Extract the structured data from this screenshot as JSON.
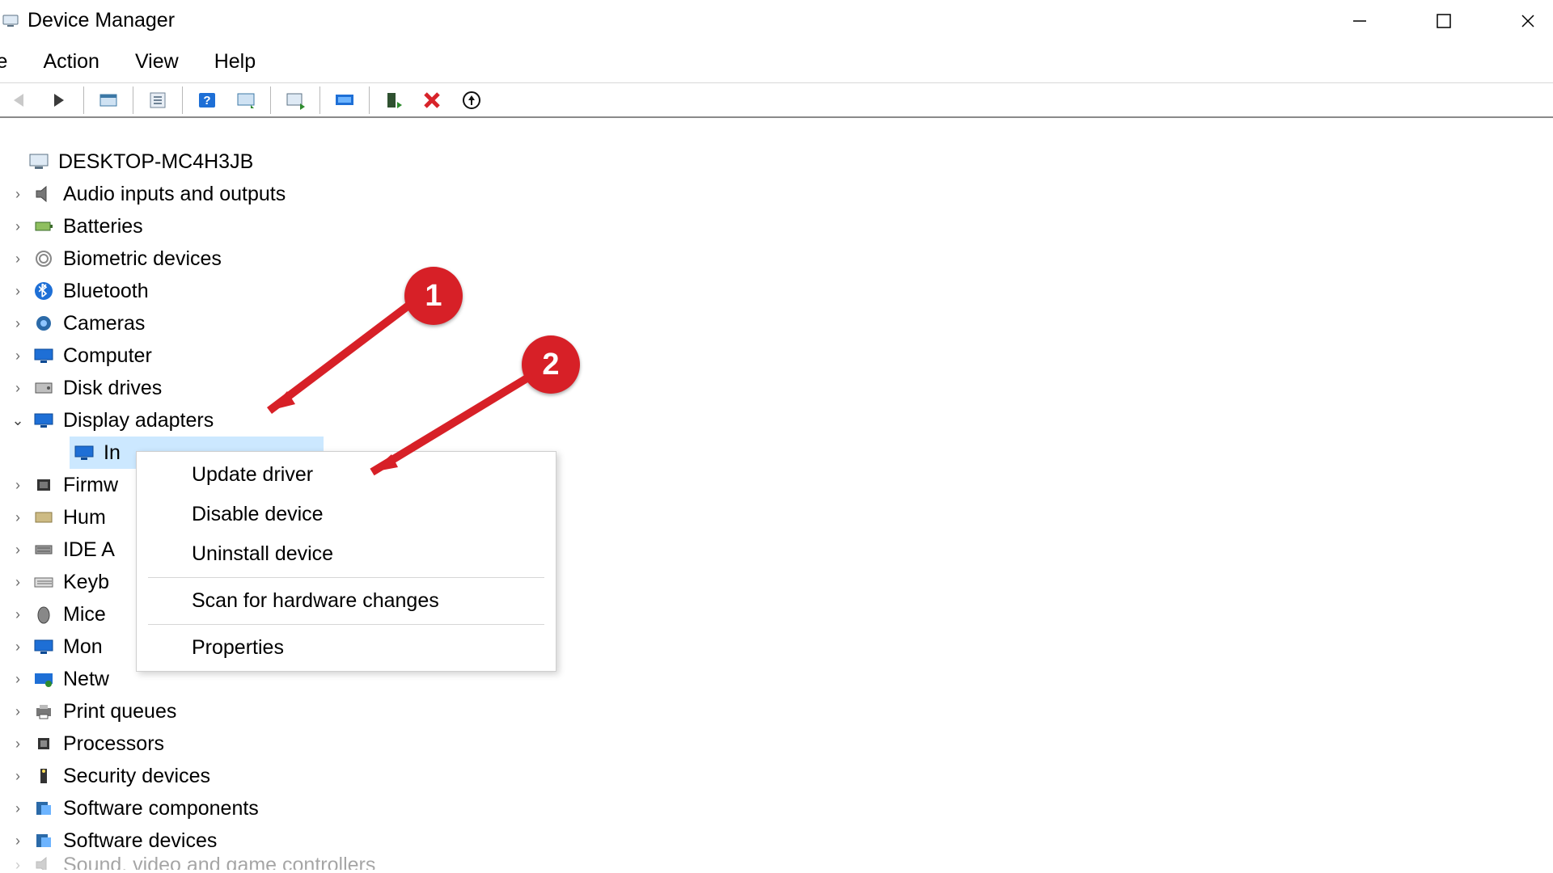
{
  "window": {
    "title": "Device Manager"
  },
  "menubar": {
    "items": [
      "le",
      "Action",
      "View",
      "Help"
    ]
  },
  "toolbar": {
    "buttons": [
      {
        "name": "back",
        "sep_after": false,
        "sep_before": false
      },
      {
        "name": "forward",
        "sep_after": true
      },
      {
        "name": "show-hidden",
        "sep_after": true
      },
      {
        "name": "properties",
        "sep_after": true
      },
      {
        "name": "help",
        "sep_after": false
      },
      {
        "name": "refresh",
        "sep_after": true
      },
      {
        "name": "update-driver",
        "sep_after": true
      },
      {
        "name": "scan-hardware",
        "sep_after": true
      },
      {
        "name": "add-legacy",
        "sep_after": false
      },
      {
        "name": "remove",
        "sep_after": false
      },
      {
        "name": "install-driver",
        "sep_after": false
      }
    ]
  },
  "tree": {
    "root": "DESKTOP-MC4H3JB",
    "categories": [
      {
        "label": "Audio inputs and outputs",
        "icon": "speaker",
        "expanded": false
      },
      {
        "label": "Batteries",
        "icon": "battery",
        "expanded": false
      },
      {
        "label": "Biometric devices",
        "icon": "fingerprint",
        "expanded": false
      },
      {
        "label": "Bluetooth",
        "icon": "bluetooth",
        "expanded": false
      },
      {
        "label": "Cameras",
        "icon": "camera",
        "expanded": false
      },
      {
        "label": "Computer",
        "icon": "monitor",
        "expanded": false
      },
      {
        "label": "Disk drives",
        "icon": "disk",
        "expanded": false
      },
      {
        "label": "Display adapters",
        "icon": "monitor",
        "expanded": true,
        "children": [
          {
            "label": "In"
          }
        ]
      },
      {
        "label": "Firmw",
        "icon": "chip",
        "expanded": false,
        "truncated": true
      },
      {
        "label": "Hum",
        "icon": "hid",
        "expanded": false,
        "truncated": true
      },
      {
        "label": "IDE A",
        "icon": "ide",
        "expanded": false,
        "truncated": true
      },
      {
        "label": "Keyb",
        "icon": "keyboard",
        "expanded": false,
        "truncated": true
      },
      {
        "label": "Mice",
        "icon": "mouse",
        "expanded": false,
        "truncated": true
      },
      {
        "label": "Mon",
        "icon": "monitor",
        "expanded": false,
        "truncated": true
      },
      {
        "label": "Netw",
        "icon": "network",
        "expanded": false,
        "truncated": true
      },
      {
        "label": "Print queues",
        "icon": "printer",
        "expanded": false
      },
      {
        "label": "Processors",
        "icon": "cpu",
        "expanded": false
      },
      {
        "label": "Security devices",
        "icon": "security",
        "expanded": false
      },
      {
        "label": "Software components",
        "icon": "software",
        "expanded": false
      },
      {
        "label": "Software devices",
        "icon": "software",
        "expanded": false
      },
      {
        "label": "Sound, video and game controllers",
        "icon": "speaker",
        "expanded": false,
        "cut": true
      }
    ]
  },
  "context_menu": {
    "items": [
      {
        "label": "Update driver"
      },
      {
        "label": "Disable device"
      },
      {
        "label": "Uninstall device"
      },
      {
        "sep": true
      },
      {
        "label": "Scan for hardware changes"
      },
      {
        "sep": true
      },
      {
        "label": "Properties"
      }
    ]
  },
  "annotations": {
    "badge1": "1",
    "badge2": "2"
  }
}
